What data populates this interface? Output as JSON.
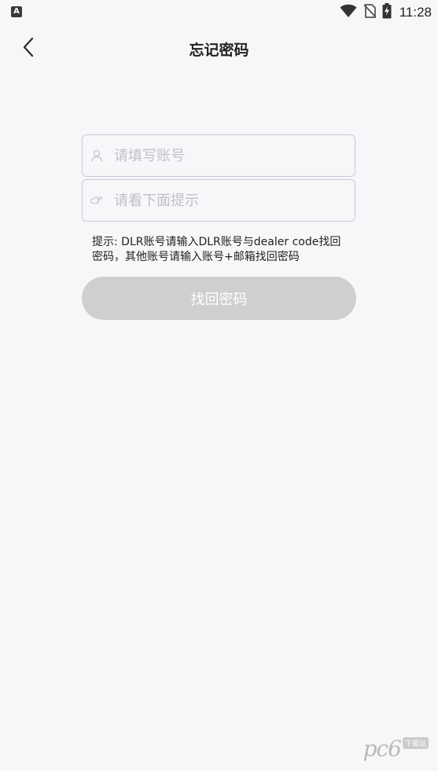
{
  "status_bar": {
    "app_icon_label": "A",
    "time": "11:28",
    "icons": [
      "wifi-icon",
      "no-sim-icon",
      "battery-charging-icon"
    ]
  },
  "header": {
    "back_icon": "chevron-left-icon",
    "title": "忘记密码"
  },
  "form": {
    "account": {
      "icon": "user-icon",
      "placeholder": "请填写账号",
      "value": ""
    },
    "hint": {
      "icon": "pointing-hand-icon",
      "placeholder": "请看下面提示",
      "value": ""
    },
    "hint_text": "提示: DLR账号请输入DLR账号与dealer code找回密码，其他账号请输入账号+邮箱找回密码",
    "submit_label": "找回密码"
  },
  "watermark": {
    "logo": "pc6",
    "tag": "下载站"
  },
  "colors": {
    "background": "#f7f7f9",
    "field_border": "#c9c9dc",
    "button_disabled": "#cfcfd1",
    "placeholder": "#c0c0c8"
  }
}
